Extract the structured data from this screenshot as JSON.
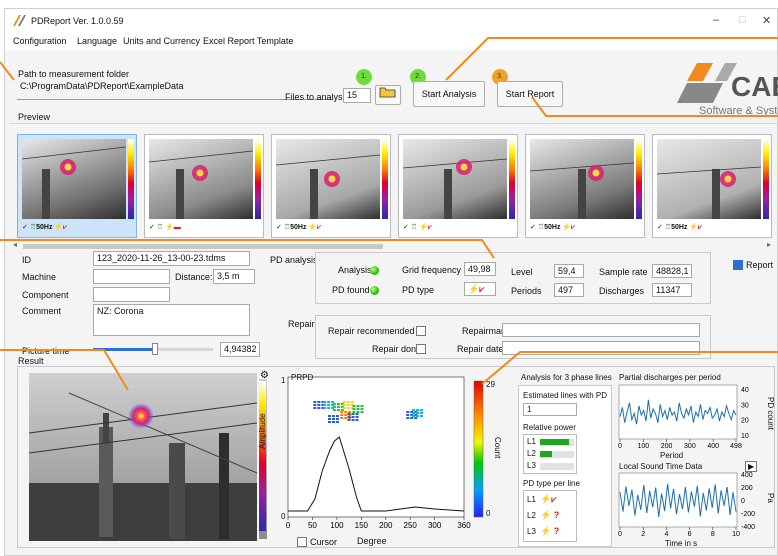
{
  "window": {
    "title": "PDReport Ver. 1.0.0.59",
    "min": "–",
    "max": "□",
    "close": "✕"
  },
  "menu": [
    "Configuration",
    "Language",
    "Units and Currency",
    "Excel Report Template"
  ],
  "path": {
    "label": "Path to measurement folder",
    "value": "C:\\ProgramData\\PDReport\\ExampleData",
    "files_label": "Files to analyse",
    "files_count": "15"
  },
  "steps": [
    {
      "badge": "1.",
      "color": "#6fdc3a"
    },
    {
      "badge": "2.",
      "color": "#6fdc3a",
      "label": "Start Analysis"
    },
    {
      "badge": "3.",
      "color": "#f0a32a",
      "label": "Start Report"
    }
  ],
  "logo": {
    "text": "CAE",
    "subtitle": "Software & Systems"
  },
  "preview": {
    "label": "Preview",
    "thumbs": [
      {
        "freq": "50Hz",
        "type": "corona"
      },
      {
        "freq": "",
        "type": "surface"
      },
      {
        "freq": "50Hz",
        "type": "corona"
      },
      {
        "freq": "",
        "type": "corona"
      },
      {
        "freq": "50Hz",
        "type": "corona"
      },
      {
        "freq": "50Hz",
        "type": "corona"
      }
    ]
  },
  "details": {
    "id_label": "ID",
    "id_value": "123_2020-11-26_13-00-23.tdms",
    "machine_label": "Machine",
    "distance_label": "Distance:",
    "distance_value": "3,5 m",
    "component_label": "Component",
    "comment_label": "Comment",
    "comment_value": "NZ: Corona",
    "picture_time_label": "Picture time",
    "picture_time_value": "4,94382",
    "picture_time_level": 0.52
  },
  "pd_analysis": {
    "label": "PD analysis",
    "analysis_label": "Analysis",
    "pd_found_label": "PD found",
    "grid_freq_label": "Grid frequency",
    "grid_freq_value": "49,98",
    "pd_type_label": "PD type",
    "level_label": "Level",
    "level_value": "59,4",
    "periods_label": "Periods",
    "periods_value": "497",
    "sample_rate_label": "Sample rate",
    "sample_rate_value": "48828,1",
    "discharges_label": "Discharges",
    "discharges_value": "11347",
    "report_label": "Report"
  },
  "repair": {
    "label": "Repair",
    "recommended_label": "Repair recommended",
    "done_label": "Repair done",
    "repairman_label": "Repairman",
    "date_label": "Repair date"
  },
  "result": {
    "label": "Result",
    "gear": "⚙"
  },
  "prpd": {
    "title": "PRPD",
    "ylabel": "Amplitude",
    "xlabel": "Degree",
    "cursor_label": "Cursor",
    "x_ticks": [
      "0",
      "50",
      "100",
      "150",
      "200",
      "250",
      "300",
      "360"
    ],
    "y_ticks": [
      "1",
      "0"
    ],
    "count_label": "Count",
    "count_max": "29",
    "count_min": "0"
  },
  "phase": {
    "title": "Analysis for 3 phase lines",
    "estimated_label": "Estimated lines with PD",
    "estimated_value": "1",
    "relative_power_label": "Relative power",
    "lines": [
      {
        "name": "L1",
        "power": 0.85,
        "type": "⚡⩗"
      },
      {
        "name": "L2",
        "power": 0.35,
        "type": "⚡ ?"
      },
      {
        "name": "L3",
        "power": 0.0,
        "type": "⚡ ?"
      }
    ],
    "pd_type_label": "PD type per line"
  },
  "chart_data": [
    {
      "type": "line",
      "title": "Partial discharges per period",
      "xlabel": "Period",
      "ylabel": "PD count",
      "x_ticks": [
        "0",
        "100",
        "200",
        "300",
        "400",
        "498"
      ],
      "y_ticks": [
        "10",
        "20",
        "30",
        "40"
      ],
      "xlim": [
        0,
        498
      ],
      "ylim": [
        8,
        42
      ],
      "series": [
        {
          "values": [
            22,
            28,
            18,
            25,
            31,
            20,
            24,
            17,
            29,
            23,
            26,
            19,
            33,
            21,
            27,
            24,
            18,
            30,
            22,
            26,
            20,
            28,
            23,
            25,
            19,
            31,
            24,
            21,
            27,
            23,
            29,
            18,
            25,
            22,
            30,
            20,
            26,
            24,
            28,
            21,
            23,
            27,
            19,
            25,
            22,
            29,
            24,
            20,
            26,
            23
          ]
        }
      ]
    },
    {
      "type": "line",
      "title": "Local Sound Time Data",
      "xlabel": "Time in s",
      "ylabel": "Pa",
      "x_ticks": [
        "0",
        "2",
        "4",
        "6",
        "8",
        "10"
      ],
      "y_ticks": [
        "-400",
        "-200",
        "0",
        "200",
        "400"
      ],
      "xlim": [
        0,
        10
      ],
      "ylim": [
        -400,
        400
      ],
      "series": [
        {
          "values": [
            120,
            -180,
            210,
            -90,
            160,
            -240,
            80,
            -150,
            230,
            -200,
            140,
            -110,
            190,
            -260,
            100,
            -170,
            250,
            -130,
            170,
            -220,
            90,
            -140,
            200,
            -190,
            130,
            -100,
            220,
            -250,
            110,
            -160,
            180,
            -120,
            240,
            -210,
            150,
            -90,
            200,
            -230,
            120,
            -180
          ]
        }
      ]
    }
  ]
}
